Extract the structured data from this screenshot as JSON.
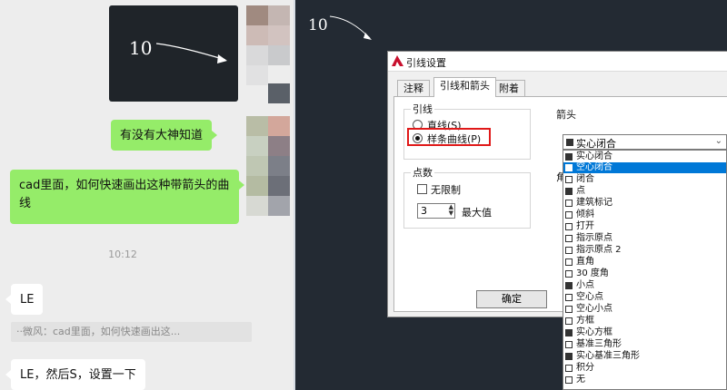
{
  "chat": {
    "image_caption": "10",
    "messages": [
      {
        "side": "right",
        "text": "有没有大神知道"
      },
      {
        "side": "right",
        "text": "cad里面，如何快速画出这种带箭头的曲线"
      }
    ],
    "timestamp": "10:12",
    "reply1": "LE",
    "quote": "··微风：cad里面，如何快速画出这...",
    "reply2": "LE，然后S，设置一下"
  },
  "cad": {
    "canvas_text": "10",
    "dialog": {
      "title": "引线设置",
      "tabs": [
        "注释",
        "引线和箭头",
        "附着"
      ],
      "active_tab": 1,
      "leader_group": "引线",
      "leader_options": [
        "直线(S)",
        "样条曲线(P)"
      ],
      "leader_selected": 1,
      "points_group": "点数",
      "unlimited_label": "无限制",
      "max_value": "3",
      "max_label": "最大值",
      "arrow_group": "箭头",
      "arrow_value": "实心闭合",
      "angle_group_partial": "角",
      "ok_label": "确定"
    },
    "arrow_options": [
      {
        "label": "实心闭合",
        "icon": "filled-arrow-icon"
      },
      {
        "label": "空心闭合",
        "icon": "hollow-arrow-icon",
        "selected": true
      },
      {
        "label": "闭合",
        "icon": "closed-arrow-icon"
      },
      {
        "label": "点",
        "icon": "dot-icon"
      },
      {
        "label": "建筑标记",
        "icon": "tick-icon"
      },
      {
        "label": "倾斜",
        "icon": "oblique-icon"
      },
      {
        "label": "打开",
        "icon": "open-arrow-icon"
      },
      {
        "label": "指示原点",
        "icon": "origin-icon"
      },
      {
        "label": "指示原点 2",
        "icon": "origin2-icon"
      },
      {
        "label": "直角",
        "icon": "right-angle-icon"
      },
      {
        "label": "30 度角",
        "icon": "angle30-icon"
      },
      {
        "label": "小点",
        "icon": "small-dot-icon"
      },
      {
        "label": "空心点",
        "icon": "hollow-dot-icon"
      },
      {
        "label": "空心小点",
        "icon": "hollow-small-dot-icon"
      },
      {
        "label": "方框",
        "icon": "box-icon"
      },
      {
        "label": "实心方框",
        "icon": "filled-box-icon"
      },
      {
        "label": "基准三角形",
        "icon": "datum-triangle-icon"
      },
      {
        "label": "实心基准三角形",
        "icon": "filled-datum-triangle-icon"
      },
      {
        "label": "积分",
        "icon": "integral-icon"
      },
      {
        "label": "无",
        "icon": "none-icon"
      }
    ],
    "colors": {
      "canvas": "#232a33",
      "selection": "#0078d7",
      "highlight": "#e01919",
      "bubble_green": "#95ec69"
    }
  }
}
